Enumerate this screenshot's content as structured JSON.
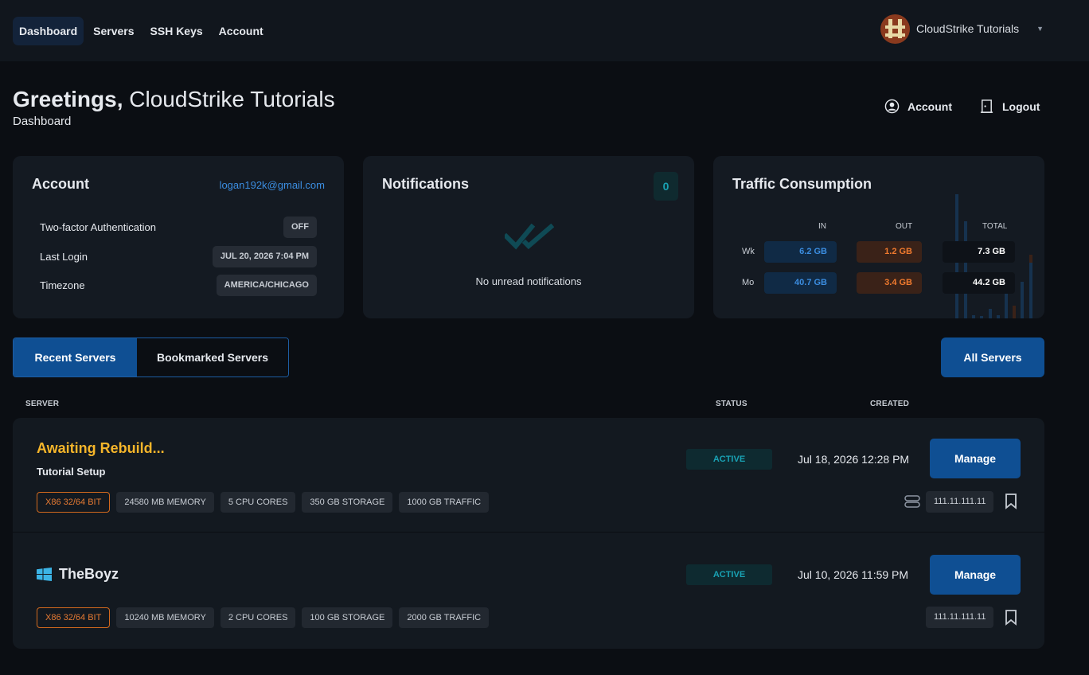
{
  "nav": {
    "links": [
      "Dashboard",
      "Servers",
      "SSH Keys",
      "Account"
    ],
    "active": "Dashboard",
    "user_name": "CloudStrike Tutorials"
  },
  "header": {
    "greeting": "Greetings,",
    "name": "CloudStrike Tutorials",
    "subtitle": "Dashboard",
    "account_label": "Account",
    "logout_label": "Logout"
  },
  "account_card": {
    "title": "Account",
    "email": "logan192k@gmail.com",
    "rows": [
      {
        "label": "Two-factor Authentication",
        "value": "OFF"
      },
      {
        "label": "Last Login",
        "value": "JUL 20, 2026 7:04 PM"
      },
      {
        "label": "Timezone",
        "value": "AMERICA/CHICAGO"
      }
    ]
  },
  "notifications_card": {
    "title": "Notifications",
    "count": "0",
    "empty_text": "No unread notifications"
  },
  "traffic_card": {
    "title": "Traffic Consumption",
    "columns": [
      "IN",
      "OUT",
      "TOTAL"
    ],
    "rows": [
      {
        "label": "Wk",
        "in": "6.2 GB",
        "out": "1.2 GB",
        "total": "7.3 GB"
      },
      {
        "label": "Mo",
        "in": "40.7 GB",
        "out": "3.4 GB",
        "total": "44.2 GB"
      }
    ]
  },
  "servers": {
    "tabs": [
      "Recent Servers",
      "Bookmarked Servers"
    ],
    "active_tab": "Recent Servers",
    "all_servers_label": "All Servers",
    "columns": [
      "SERVER",
      "STATUS",
      "CREATED"
    ],
    "manage_label": "Manage",
    "list": [
      {
        "name": "Awaiting Rebuild...",
        "subtitle": "Tutorial Setup",
        "status": "ACTIVE",
        "created": "Jul 18, 2026 12:28 PM",
        "chips": [
          "X86 32/64 BIT",
          "24580 MB MEMORY",
          "5 CPU CORES",
          "350 GB STORAGE",
          "1000 GB TRAFFIC"
        ],
        "ip": "111.11.111.11",
        "os_icon": "server-stack-icon"
      },
      {
        "name": "TheBoyz",
        "subtitle": "",
        "status": "ACTIVE",
        "created": "Jul 10, 2026 11:59 PM",
        "chips": [
          "X86 32/64 BIT",
          "10240 MB MEMORY",
          "2 CPU CORES",
          "100 GB STORAGE",
          "2000 GB TRAFFIC"
        ],
        "ip": "111.11.111.11",
        "os_icon": "windows-icon"
      }
    ]
  },
  "colors": {
    "accent_blue": "#0f4f93",
    "status_teal": "#19a2b4",
    "warning_yellow": "#f5b52a",
    "arch_orange": "#e67a33"
  }
}
